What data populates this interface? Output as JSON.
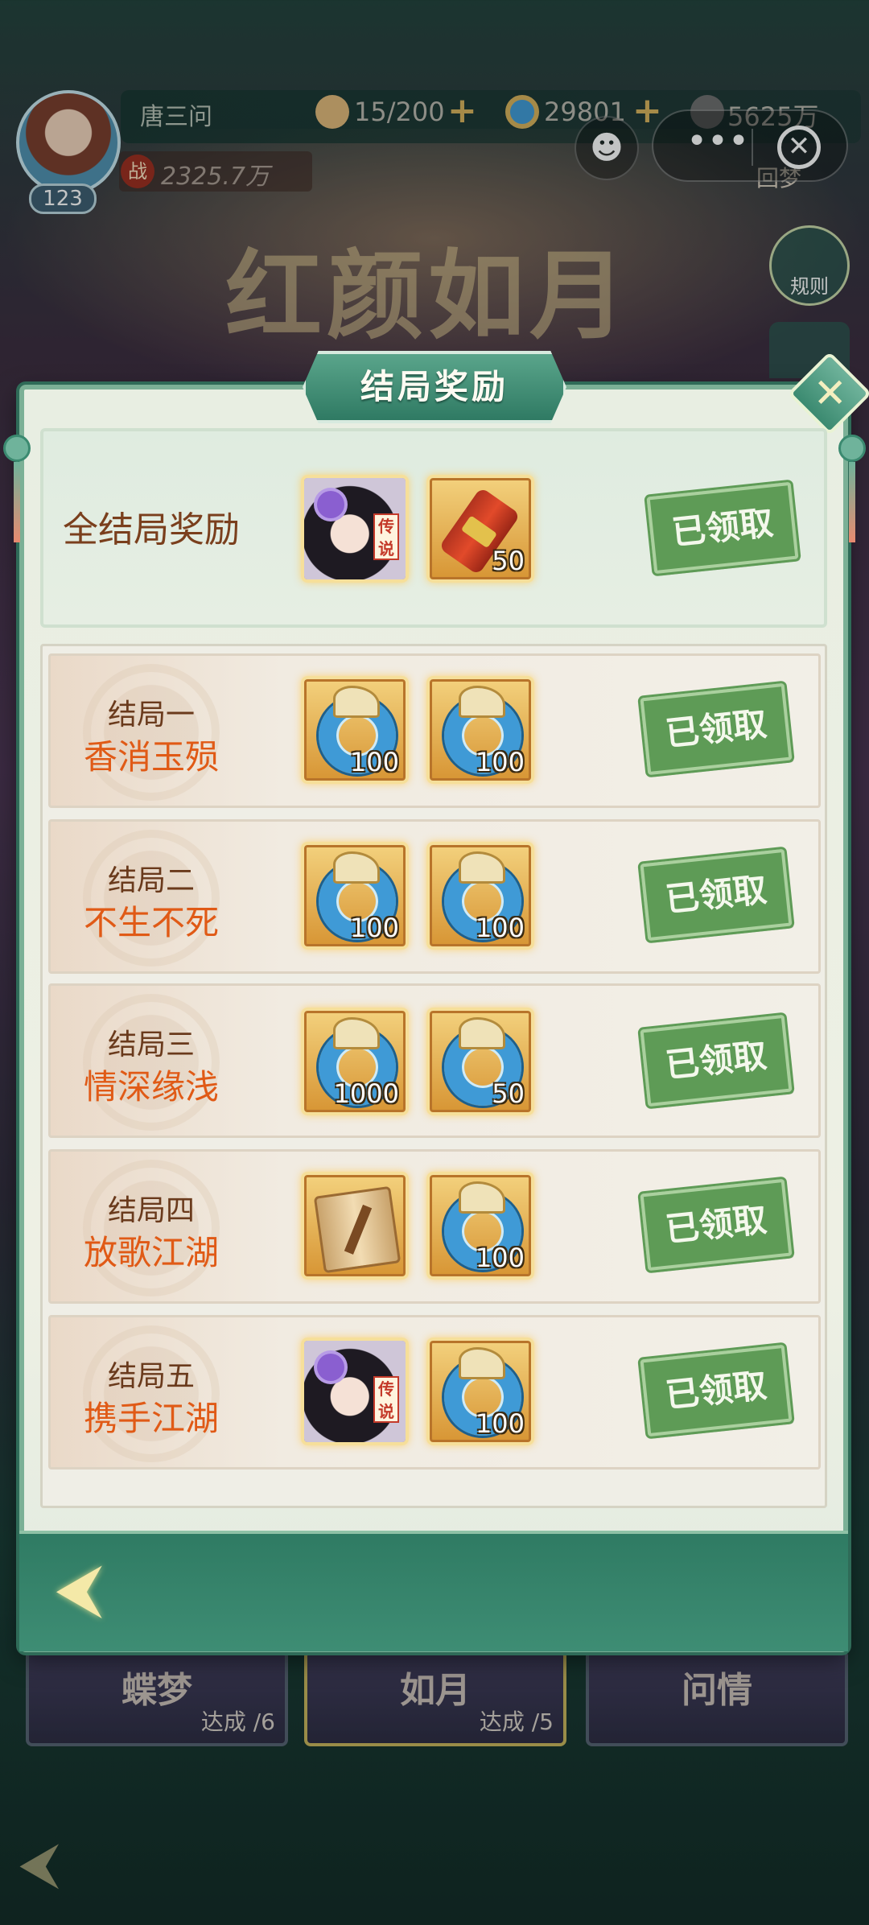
{
  "hud": {
    "player_name": "唐三问",
    "level": "123",
    "power_icon": "战",
    "power": "2325.7万",
    "stamina": "15/200",
    "jade": "29801",
    "coins": "5625万"
  },
  "event_title": "红颜如月",
  "side": {
    "rules_label": "规则",
    "dream_label": "回梦"
  },
  "capsule": {
    "more_glyph": "•••",
    "close_glyph": "✕",
    "game_glyph": "☻"
  },
  "modal": {
    "title": "结局奖励",
    "close_glyph": "✕",
    "all_rewards": {
      "label": "全结局奖励",
      "rewards": [
        {
          "icon": "legendary-companion-portrait-icon",
          "tag": "传说"
        },
        {
          "icon": "red-scroll-icon",
          "qty": "50"
        }
      ],
      "status": "已领取"
    },
    "endings": [
      {
        "label": "结局一",
        "name": "香消玉殒",
        "rewards": [
          {
            "icon": "jade-ring-icon",
            "qty": "100"
          },
          {
            "icon": "jade-ring-icon",
            "qty": "100"
          }
        ],
        "status": "已领取"
      },
      {
        "label": "结局二",
        "name": "不生不死",
        "rewards": [
          {
            "icon": "jade-ring-icon",
            "qty": "100"
          },
          {
            "icon": "jade-ring-icon",
            "qty": "100"
          }
        ],
        "status": "已领取"
      },
      {
        "label": "结局三",
        "name": "情深缘浅",
        "rewards": [
          {
            "icon": "jade-ring-icon",
            "qty": "1000"
          },
          {
            "icon": "jade-ring-icon",
            "qty": "50"
          }
        ],
        "status": "已领取"
      },
      {
        "label": "结局四",
        "name": "放歌江湖",
        "rewards": [
          {
            "icon": "map-scroll-icon"
          },
          {
            "icon": "jade-ring-icon",
            "qty": "100"
          }
        ],
        "status": "已领取"
      },
      {
        "label": "结局五",
        "name": "携手江湖",
        "rewards": [
          {
            "icon": "legendary-companion-portrait-icon",
            "tag": "传说"
          },
          {
            "icon": "jade-ring-icon",
            "qty": "100"
          }
        ],
        "status": "已领取"
      }
    ],
    "back_glyph": "⮜"
  },
  "chapters": [
    {
      "name": "蝶梦",
      "progress_label": "达成",
      "progress": "/6"
    },
    {
      "name": "如月",
      "progress_label": "达成",
      "progress": "/5"
    },
    {
      "name": "问情",
      "progress_label": "",
      "progress": ""
    }
  ],
  "bottom_back_glyph": "⮜"
}
